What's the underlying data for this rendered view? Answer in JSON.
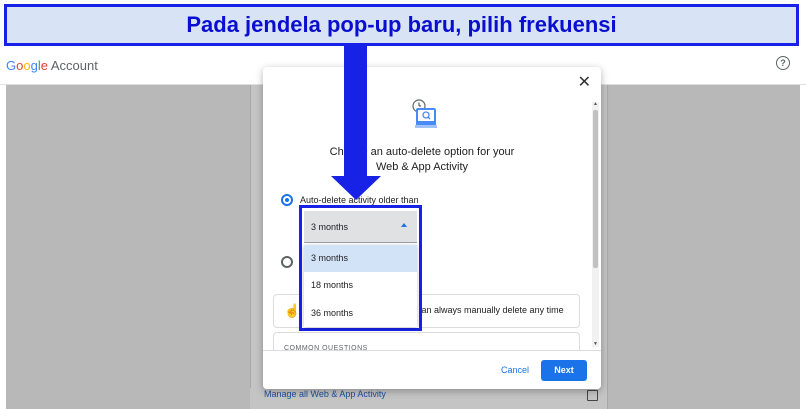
{
  "annotation": {
    "banner_text": "Pada jendela pop-up baru, pilih frekuensi",
    "accent_color": "#1722e6"
  },
  "header": {
    "logo_text_google": "Google",
    "logo_text_account": "Account",
    "help_icon": "help-circle-icon"
  },
  "modal": {
    "close_icon": "close-icon",
    "title_line1": "Choose an auto-delete option for your",
    "title_line2": "Web & App Activity",
    "option1_label": "Auto-delete activity older than",
    "info_text": "can always manually delete any time",
    "questions_label": "COMMON QUESTIONS",
    "cancel_label": "Cancel",
    "next_label": "Next"
  },
  "dropdown": {
    "selected_value": "3 months",
    "options": [
      "3 months",
      "18 months",
      "36 months"
    ]
  },
  "background": {
    "bottom_link": "Manage all Web & App Activity"
  }
}
